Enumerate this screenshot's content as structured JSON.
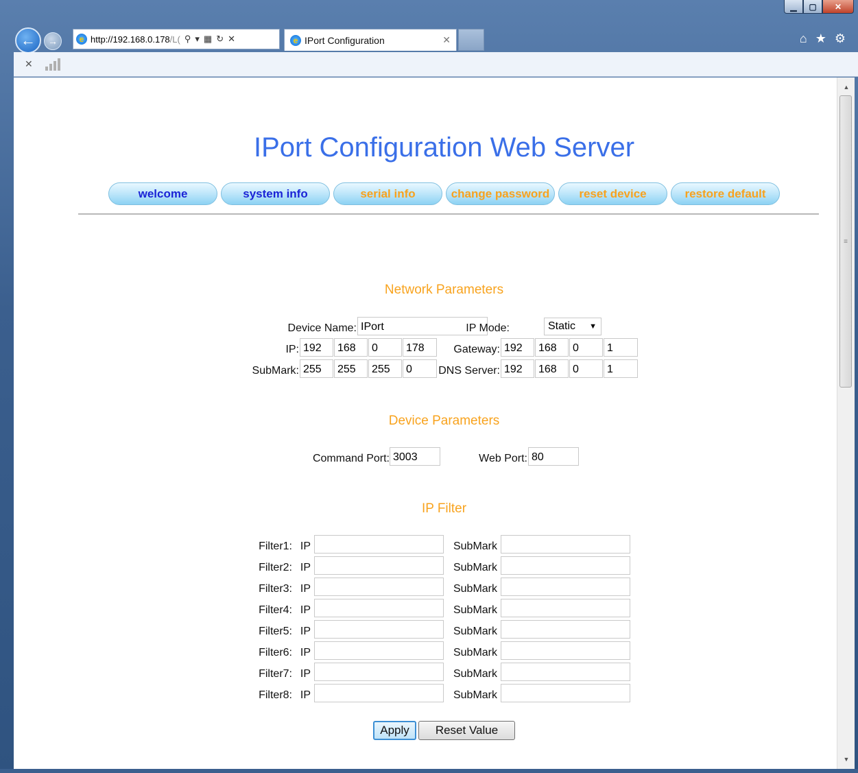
{
  "browser": {
    "url_host": "http://192.168.0.178",
    "url_rest": "/L(",
    "tab_title": "IPort Configuration"
  },
  "page": {
    "title": "IPort Configuration Web Server",
    "nav": [
      {
        "label": "welcome",
        "color": "#1b24d6"
      },
      {
        "label": "system info",
        "color": "#1b24d6"
      },
      {
        "label": "serial info",
        "color": "#f7a21e"
      },
      {
        "label": "change password",
        "color": "#f7a21e"
      },
      {
        "label": "reset device",
        "color": "#f7a21e"
      },
      {
        "label": "restore default",
        "color": "#f7a21e"
      }
    ]
  },
  "network": {
    "heading": "Network Parameters",
    "device_name_label": "Device Name:",
    "device_name": "IPort",
    "ip_mode_label": "IP Mode:",
    "ip_mode": "Static",
    "ip_label": "IP:",
    "ip": [
      "192",
      "168",
      "0",
      "178"
    ],
    "gateway_label": "Gateway:",
    "gateway": [
      "192",
      "168",
      "0",
      "1"
    ],
    "submask_label": "SubMark:",
    "submask": [
      "255",
      "255",
      "255",
      "0"
    ],
    "dns_label": "DNS Server:",
    "dns": [
      "192",
      "168",
      "0",
      "1"
    ]
  },
  "device": {
    "heading": "Device Parameters",
    "command_port_label": "Command Port:",
    "command_port": "3003",
    "web_port_label": "Web Port:",
    "web_port": "80"
  },
  "ipfilter": {
    "heading": "IP Filter",
    "ip_label": "IP",
    "submask_label": "SubMark",
    "rows": [
      {
        "label": "Filter1:",
        "ip": "",
        "mask": ""
      },
      {
        "label": "Filter2:",
        "ip": "",
        "mask": ""
      },
      {
        "label": "Filter3:",
        "ip": "",
        "mask": ""
      },
      {
        "label": "Filter4:",
        "ip": "",
        "mask": ""
      },
      {
        "label": "Filter5:",
        "ip": "",
        "mask": ""
      },
      {
        "label": "Filter6:",
        "ip": "",
        "mask": ""
      },
      {
        "label": "Filter7:",
        "ip": "",
        "mask": ""
      },
      {
        "label": "Filter8:",
        "ip": "",
        "mask": ""
      }
    ]
  },
  "actions": {
    "apply": "Apply",
    "reset": "Reset Value"
  }
}
